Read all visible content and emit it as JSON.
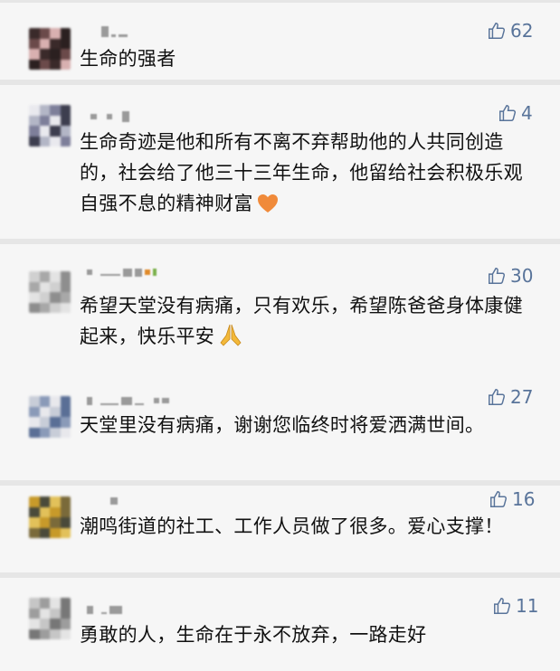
{
  "comments": [
    {
      "text": "生命的强者",
      "likes": "62",
      "emoji": "",
      "avatar_colors": [
        "#3a2a2a",
        "#6b4a4a",
        "#d8b0b0",
        "#2b2020"
      ]
    },
    {
      "text": "生命奇迹是他和所有不离不弃帮助他的人共同创造的，社会给了他三十三年生命，他留给社会积极乐观自强不息的精神财富",
      "likes": "4",
      "emoji": "orange-heart",
      "avatar_colors": [
        "#e9e9ee",
        "#b3b6c6",
        "#7e7f9a",
        "#3d3e4f"
      ]
    },
    {
      "text": "希望天堂没有病痛，只有欢乐，希望陈爸爸身体康健起来，快乐平安",
      "likes": "30",
      "emoji": "folded-hands",
      "avatar_colors": [
        "#d0d0d0",
        "#a8a8a8",
        "#e3e3e3",
        "#8e8e8e"
      ]
    },
    {
      "text": "天堂里没有病痛，谢谢您临终时将爱洒满世间。",
      "likes": "27",
      "emoji": "",
      "avatar_colors": [
        "#c8cdd8",
        "#8a9ab8",
        "#e8e8ec",
        "#5a6f96"
      ]
    },
    {
      "text": "潮鸣街道的社工、工作人员做了很多。爱心支撑！",
      "likes": "16",
      "emoji": "",
      "avatar_colors": [
        "#c79a2a",
        "#4a4a3a",
        "#e2c15a",
        "#7a6a3a"
      ]
    },
    {
      "text": "勇敢的人，生命在于永不放弃，一路走好",
      "likes": "11",
      "emoji": "",
      "avatar_colors": [
        "#c6c6c6",
        "#9d9d9d",
        "#e4e4e4",
        "#777777"
      ]
    }
  ]
}
